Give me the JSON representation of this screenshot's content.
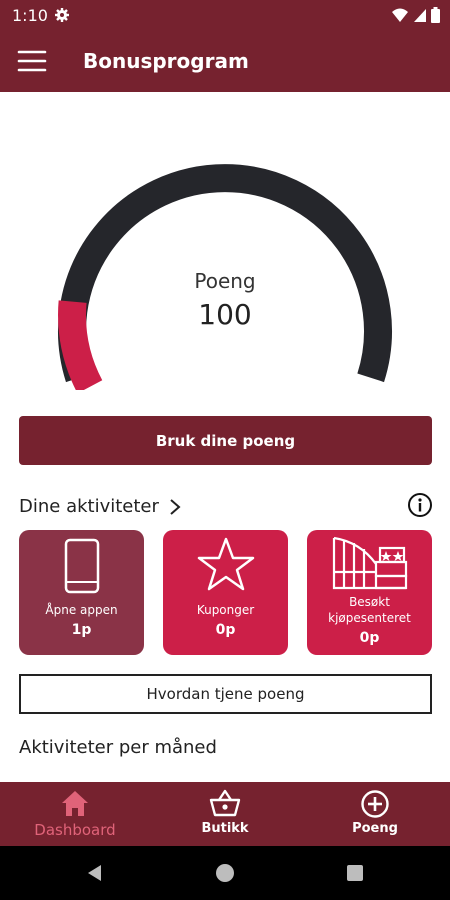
{
  "status_bar": {
    "time": "1:10"
  },
  "app_bar": {
    "title": "Bonusprogram"
  },
  "gauge": {
    "label": "Poeng",
    "value": "100",
    "fill_fraction": 0.14
  },
  "use_points_button": "Bruk dine poeng",
  "activities": {
    "title": "Dine aktiviteter",
    "cards": [
      {
        "label": "Åpne appen",
        "points": "1p"
      },
      {
        "label": "Kuponger",
        "points": "0p"
      },
      {
        "label": "Besøkt kjøpesenteret",
        "points": "0p"
      }
    ]
  },
  "earn_button": "Hvordan tjene poeng",
  "monthly_title": "Aktiviteter per måned",
  "bottom_nav": {
    "items": [
      {
        "label": "Dashboard",
        "icon": "home-icon"
      },
      {
        "label": "Butikk",
        "icon": "basket-icon"
      },
      {
        "label": "Poeng",
        "icon": "plus-circle-icon"
      }
    ]
  },
  "colors": {
    "brand": "#76222f",
    "accent": "#cc1f48",
    "gauge_track": "#25262b",
    "active_nav": "#e06379"
  }
}
